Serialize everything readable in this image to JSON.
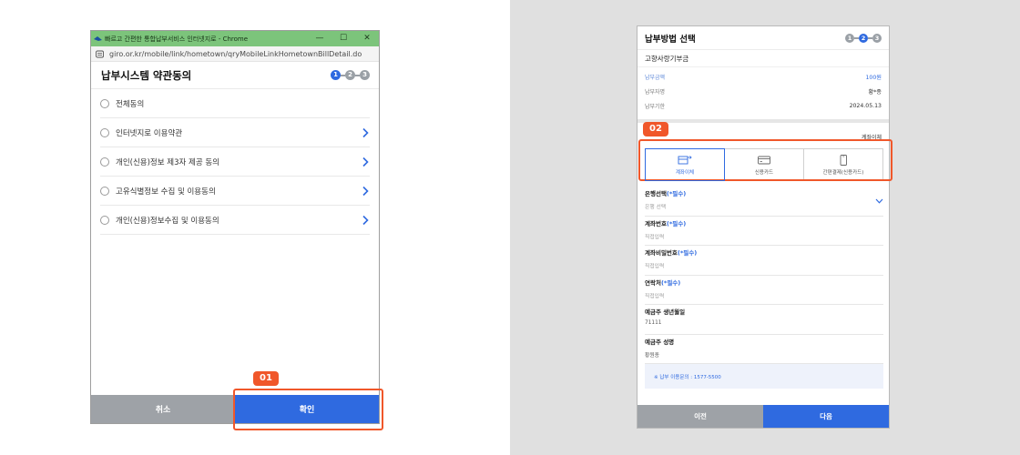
{
  "left": {
    "window_title": "빠르고 간편한 통합납부서비스 인터넷지로 - Chrome",
    "window_controls": [
      "—",
      "☐",
      "✕"
    ],
    "address_url": "giro.or.kr/mobile/link/hometown/qryMobileLinkHometownBillDetail.do",
    "page_title": "납부시스템 약관동의",
    "steps": [
      "1",
      "2",
      "3"
    ],
    "agree_items": [
      {
        "label": "전체동의"
      },
      {
        "label": "인터넷지로 이용약관"
      },
      {
        "label": "개인(신용)정보 제3자 제공 동의"
      },
      {
        "label": "고유식별정보 수집 및 이용동의"
      },
      {
        "label": "개인(신용)정보수집 및 이용동의"
      }
    ],
    "cancel_label": "취소",
    "confirm_label": "확인",
    "badge": "01"
  },
  "right": {
    "page_title": "납부방법 선택",
    "steps": [
      "1",
      "2",
      "3"
    ],
    "org_name": "고향사랑기부금",
    "info": [
      {
        "label": "납부금액",
        "value": "100원"
      },
      {
        "label": "납부자명",
        "value": "황*종"
      },
      {
        "label": "납부기한",
        "value": "2024.05.13"
      }
    ],
    "method_selected_label": "계좌이체",
    "badge": "02",
    "methods": [
      {
        "label": "계좌이체"
      },
      {
        "label": "신용카드"
      },
      {
        "label": "간편결제(신용카드)"
      }
    ],
    "form": {
      "bank": {
        "label": "은행선택",
        "req": "(*필수)",
        "value": "은행 선택"
      },
      "account_no": {
        "label": "계좌번호",
        "req": "(*필수)",
        "value": "직접입력"
      },
      "account_pw": {
        "label": "계좌비밀번호",
        "req": "(*필수)",
        "value": "직접입력"
      },
      "contact": {
        "label": "연락처",
        "req": "(*필수)",
        "value": "직접입력"
      },
      "birth": {
        "label": "예금주 생년월일",
        "value": "71111"
      },
      "holder": {
        "label": "예금주 성명",
        "value": "황원종"
      }
    },
    "notice": "※ 납부 이용문의 : 1577-5500",
    "prev_label": "이전",
    "next_label": "다음"
  },
  "colors": {
    "accent": "#2f6ae0",
    "highlight": "#f0572a",
    "gray_button": "#9ea2a7",
    "titlebar": "#7cc47b"
  }
}
